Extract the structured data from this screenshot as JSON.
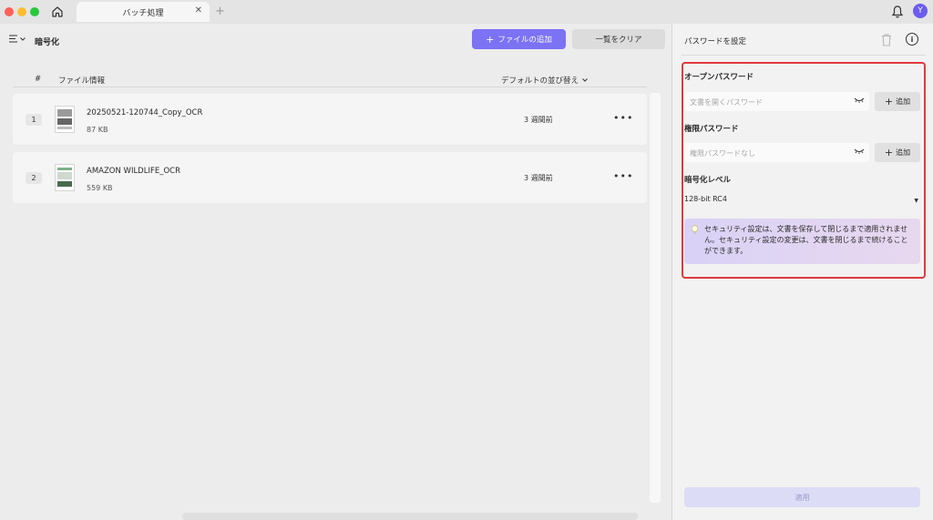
{
  "window": {
    "tab_title": "バッチ処理",
    "avatar_initial": "Y"
  },
  "main": {
    "title": "暗号化",
    "add_file_label": "ファイルの追加",
    "clear_list_label": "一覧をクリア",
    "header": {
      "num": "#",
      "info": "ファイル情報",
      "sort": "デフォルトの並び替え"
    },
    "files": [
      {
        "index": "1",
        "name": "20250521-120744_Copy_OCR",
        "size": "87 KB",
        "time": "3 週間前"
      },
      {
        "index": "2",
        "name": "AMAZON WILDLIFE_OCR",
        "size": "559 KB",
        "time": "3 週間前"
      }
    ]
  },
  "panel": {
    "title": "パスワードを設定",
    "open_password_label": "オープンパスワード",
    "open_password_placeholder": "文書を開くパスワード",
    "permission_password_label": "権限パスワード",
    "permission_password_placeholder": "権限パスワードなし",
    "add_label": "追加",
    "level_label": "暗号化レベル",
    "level_value": "128-bit RC4",
    "notice": "セキュリティ設定は、文書を保存して閉じるまで適用されません。セキュリティ設定の変更は、文書を閉じるまで続けることができます。",
    "apply_label": "適用"
  },
  "colors": {
    "accent": "#7b72f4",
    "highlight_border": "#e0393e",
    "notice_bg": "#d9d2f6"
  }
}
